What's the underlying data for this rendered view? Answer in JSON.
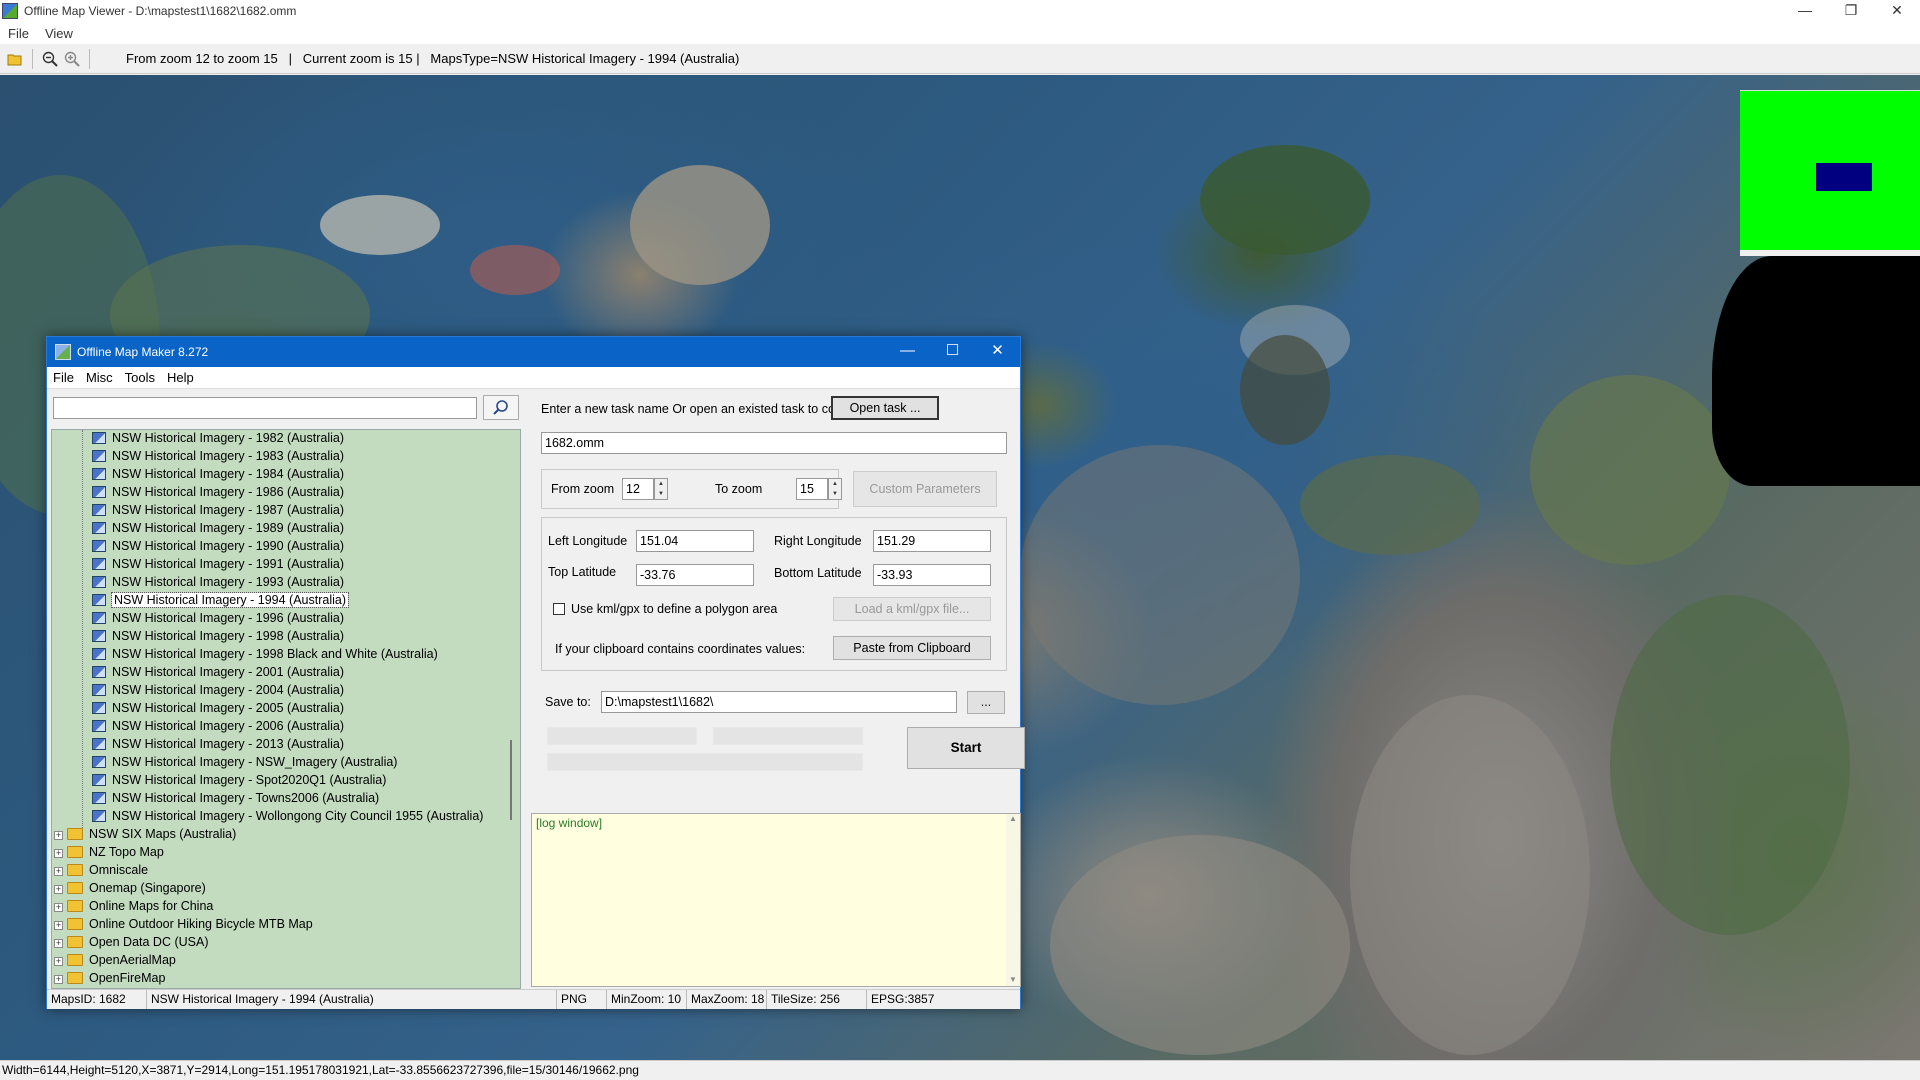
{
  "window": {
    "title": "Offline Map Viewer - D:\\mapstest1\\1682\\1682.omm",
    "controls": {
      "minimize": "—",
      "maximize": "❐",
      "close": "✕"
    }
  },
  "menubar": {
    "file": "File",
    "view": "View"
  },
  "toolbar": {
    "info": "From zoom 12 to zoom 15   |   Current zoom is 15 |   MapsType=NSW Historical Imagery - 1994 (Australia)"
  },
  "statusbar": {
    "text": "Width=6144,Height=5120,X=3871,Y=2914,Long=151.195178031921,Lat=-33.8556623727396,file=15/30146/19662.png"
  },
  "dialog": {
    "title": "Offline Map Maker 8.272",
    "controls": {
      "minimize": "—",
      "maximize": "☐",
      "close": "✕"
    },
    "menu": {
      "file": "File",
      "misc": "Misc",
      "tools": "Tools",
      "help": "Help"
    },
    "search": {
      "value": "",
      "icon": "search-icon"
    },
    "tree": {
      "leaves": [
        "NSW Historical Imagery - 1982 (Australia)",
        "NSW Historical Imagery - 1983 (Australia)",
        "NSW Historical Imagery - 1984 (Australia)",
        "NSW Historical Imagery - 1986 (Australia)",
        "NSW Historical Imagery - 1987 (Australia)",
        "NSW Historical Imagery - 1989 (Australia)",
        "NSW Historical Imagery - 1990 (Australia)",
        "NSW Historical Imagery - 1991 (Australia)",
        "NSW Historical Imagery - 1993 (Australia)",
        "NSW Historical Imagery - 1994 (Australia)",
        "NSW Historical Imagery - 1996 (Australia)",
        "NSW Historical Imagery - 1998 (Australia)",
        "NSW Historical Imagery - 1998 Black and White (Australia)",
        "NSW Historical Imagery - 2001 (Australia)",
        "NSW Historical Imagery - 2004 (Australia)",
        "NSW Historical Imagery - 2005 (Australia)",
        "NSW Historical Imagery - 2006 (Australia)",
        "NSW Historical Imagery - 2013 (Australia)",
        "NSW Historical Imagery - NSW_Imagery (Australia)",
        "NSW Historical Imagery - Spot2020Q1 (Australia)",
        "NSW Historical Imagery - Towns2006 (Australia)",
        "NSW Historical Imagery - Wollongong City Council 1955 (Australia)"
      ],
      "selected_index": 9,
      "folders": [
        "NSW SIX Maps (Australia)",
        "NZ Topo Map",
        "Omniscale",
        "Onemap (Singapore)",
        "Online Maps for China",
        "Online Outdoor Hiking Bicycle MTB Map",
        "Open Data DC (USA)",
        "OpenAerialMap",
        "OpenFireMap"
      ],
      "expander": "+"
    },
    "task": {
      "prompt": "Enter a new task name Or open an existed task to continue:",
      "open_button": "Open task ...",
      "name_value": "1682.omm"
    },
    "zoom": {
      "from_label": "From zoom",
      "from_value": "12",
      "to_label": "To zoom",
      "to_value": "15",
      "custom_button": "Custom Parameters"
    },
    "coords": {
      "left_lon_label": "Left Longitude",
      "left_lon_value": "151.04",
      "right_lon_label": "Right Longitude",
      "right_lon_value": "151.29",
      "top_lat_label": "Top Latitude",
      "top_lat_value": "-33.76",
      "bottom_lat_label": "Bottom Latitude",
      "bottom_lat_value": "-33.93",
      "kml_checkbox_label": "Use kml/gpx to define a polygon area",
      "kml_button": "Load a kml/gpx file...",
      "clipboard_label": "If your clipboard contains coordinates values:",
      "clipboard_button": "Paste from Clipboard"
    },
    "save": {
      "label": "Save to:",
      "value": "D:\\mapstest1\\1682\\",
      "browse_button": "...",
      "start_button": "Start"
    },
    "log": {
      "text": "[log window]"
    },
    "status": {
      "maps_id": "MapsID: 1682",
      "name": "NSW Historical Imagery - 1994 (Australia)",
      "format": "PNG",
      "min_zoom": "MinZoom: 10",
      "max_zoom": "MaxZoom: 18",
      "tile_size": "TileSize: 256",
      "epsg": "EPSG:3857"
    }
  }
}
